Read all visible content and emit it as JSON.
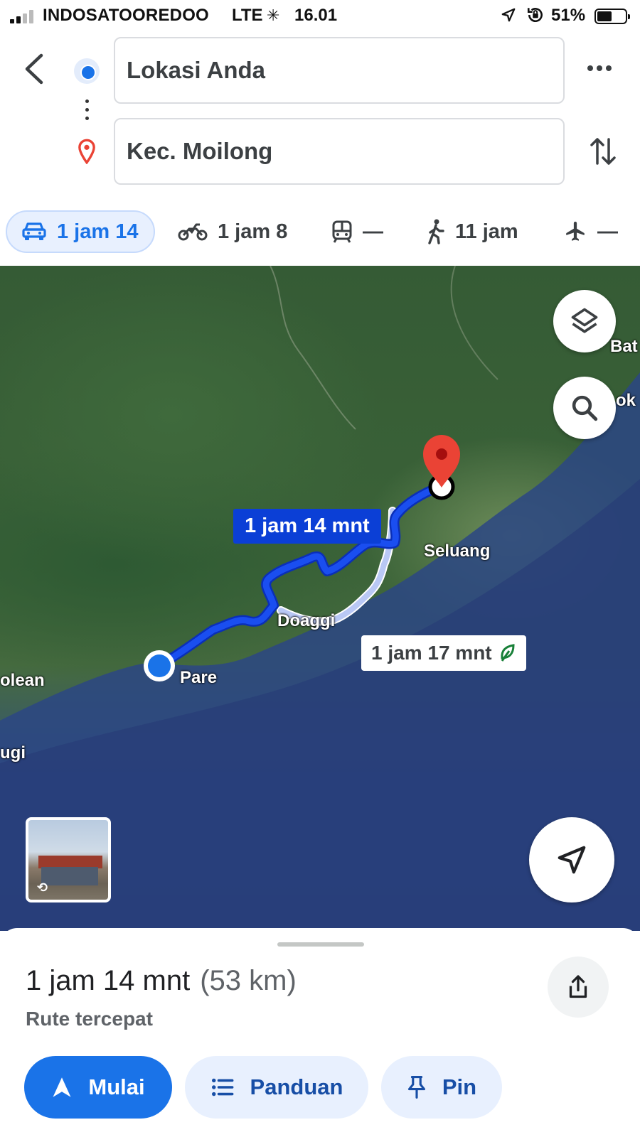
{
  "status_bar": {
    "carrier": "INDOSATOOREDOO",
    "network": "LTE",
    "time": "16.01",
    "battery_percent": "51%",
    "battery_level": 0.51
  },
  "directions": {
    "origin": "Lokasi Anda",
    "destination": "Kec. Moilong"
  },
  "travel_modes": [
    {
      "mode": "car",
      "icon": "car-icon",
      "label": "1 jam 14",
      "active": true
    },
    {
      "mode": "motorcycle",
      "icon": "motorcycle-icon",
      "label": "1 jam 8",
      "active": false
    },
    {
      "mode": "transit",
      "icon": "train-icon",
      "label": "—",
      "active": false
    },
    {
      "mode": "walk",
      "icon": "walk-icon",
      "label": "11 jam",
      "active": false
    },
    {
      "mode": "flight",
      "icon": "airplane-icon",
      "label": "—",
      "active": false
    }
  ],
  "map": {
    "route_primary_label": "1 jam 14 mnt",
    "route_alt_label": "1 jam 17 mnt",
    "places": {
      "seluang": "Seluang",
      "doaggi": "Doaggi",
      "pare": "Pare",
      "olean": "olean",
      "ugi": "ugi",
      "bat": "Bat",
      "ok": "ok"
    },
    "colors": {
      "route_primary": "#1a4ef0",
      "route_alt": "#b9c8f5",
      "origin_dot": "#1a73e8",
      "destination_pin": "#ea4335"
    }
  },
  "bottom_sheet": {
    "duration": "1 jam 14 mnt",
    "distance": "(53 km)",
    "subtitle": "Rute tercepat",
    "buttons": {
      "start": "Mulai",
      "guide": "Panduan",
      "pin": "Pin"
    }
  }
}
